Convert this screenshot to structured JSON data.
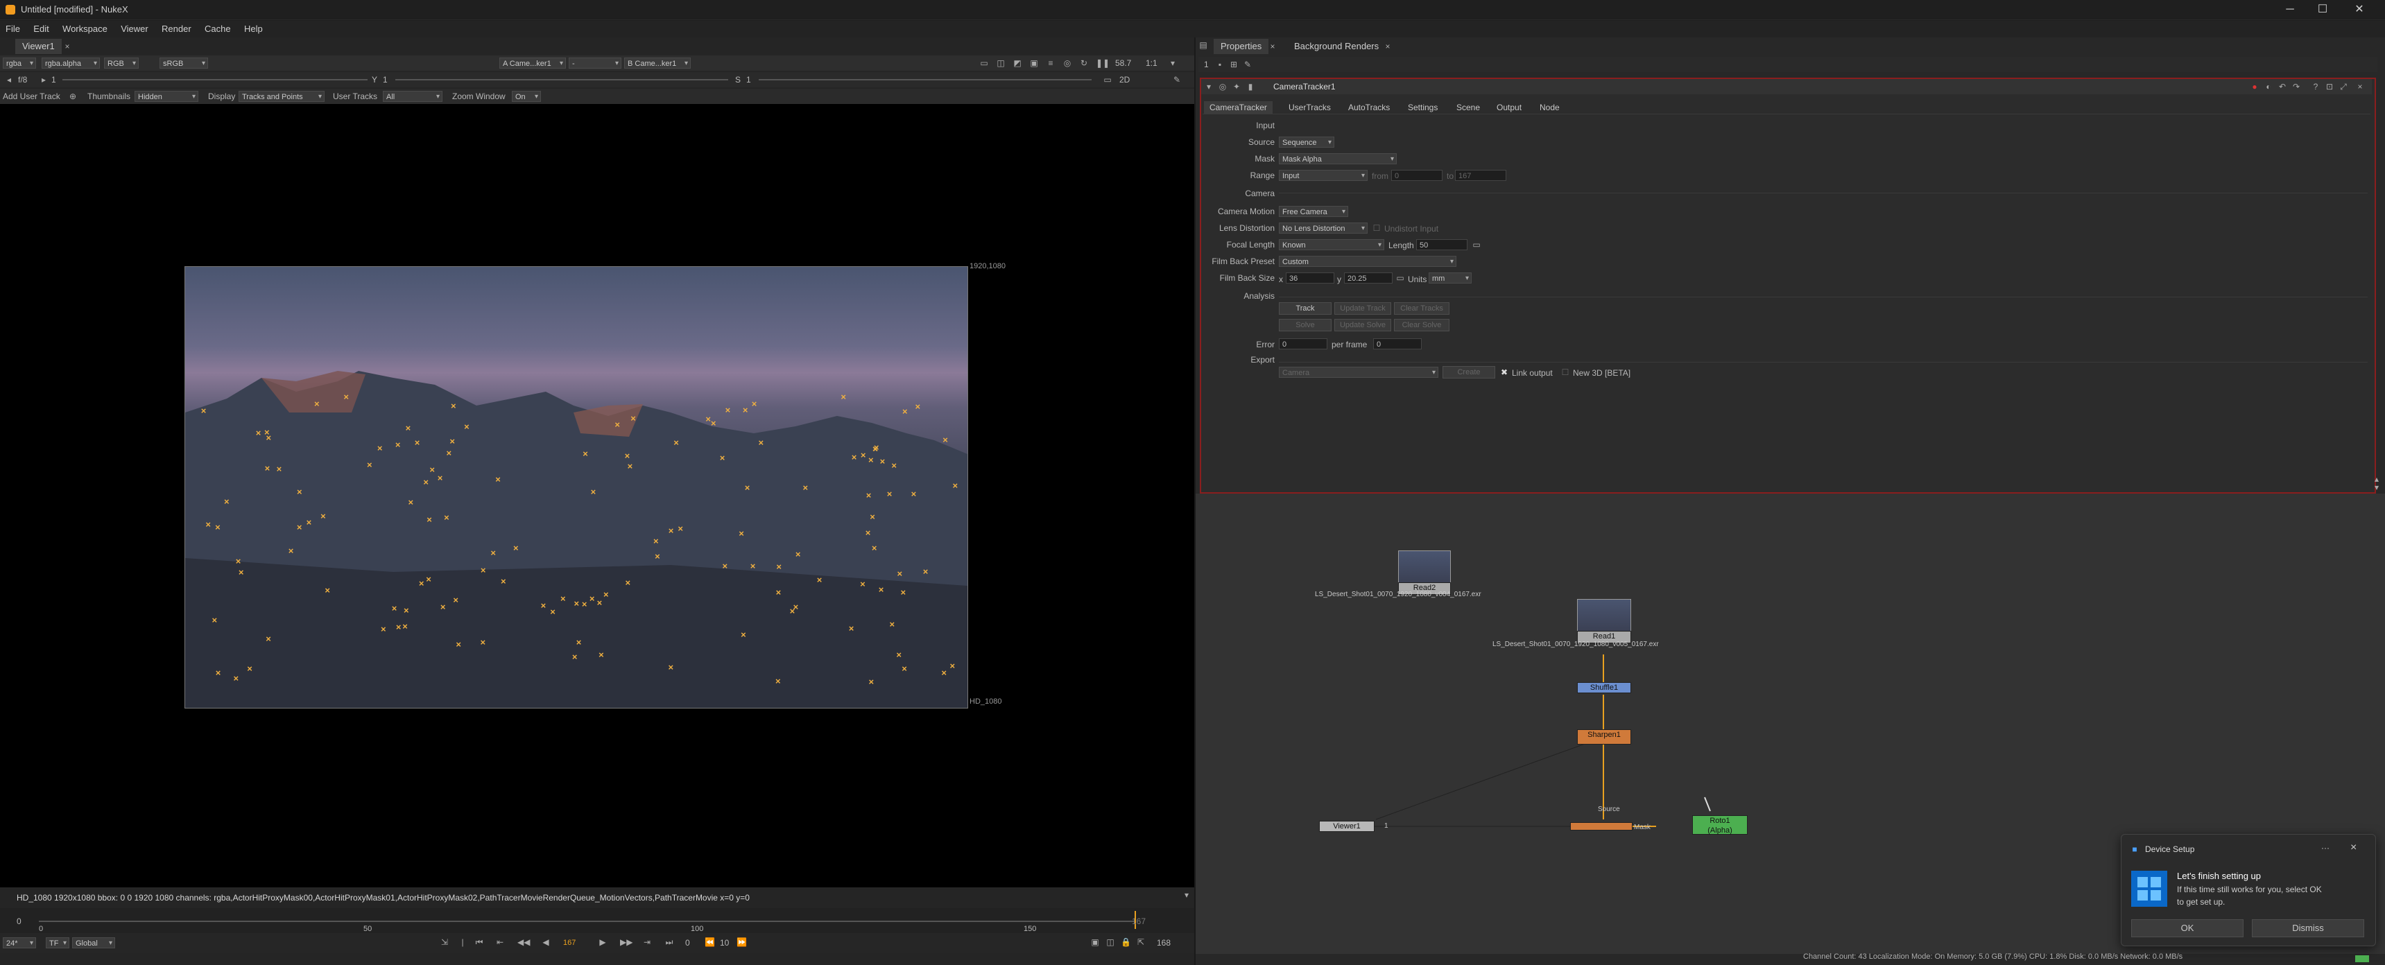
{
  "window": {
    "title": "Untitled [modified] - NukeX"
  },
  "menu": [
    "File",
    "Edit",
    "Workspace",
    "Viewer",
    "Render",
    "Cache",
    "Help"
  ],
  "viewer": {
    "tab": "Viewer1",
    "channels": "rgba",
    "alpha": "rgba.alpha",
    "colorspace_rgb": "RGB",
    "lut": "sRGB",
    "input_a": "A  Came...ker1",
    "input_a_op": "-",
    "input_b": "B  Came...ker1",
    "zoom": "58.7",
    "ratio": "1:1",
    "view_mode": "2D",
    "f_value": "f/8",
    "gain_value": "1",
    "y_value": "1",
    "s_value": "1",
    "tool_add_user_track": "Add User Track",
    "tool_thumbnails": "Thumbnails",
    "tool_thumbnails_val": "Hidden",
    "tool_display": "Display",
    "tool_display_val": "Tracks and Points",
    "tool_user_tracks": "User Tracks",
    "tool_user_tracks_val": "All",
    "tool_zoom_window": "Zoom Window",
    "tool_zoom_window_val": "On",
    "format_tr": "1920,1080",
    "format_br": "HD_1080",
    "info_line": "HD_1080 1920x1080  bbox: 0 0 1920 1080 channels: rgba,ActorHitProxyMask00,ActorHitProxyMask01,ActorHitProxyMask02,PathTracerMovieRenderQueue_MotionVectors,PathTracerMovie  x=0 y=0"
  },
  "timeline": {
    "start": "0",
    "end": "167",
    "ticks": [
      "0",
      "50",
      "100",
      "150"
    ],
    "current": "167",
    "fps": "24*",
    "tf": "TF",
    "global": "Global",
    "frame_field": "167",
    "step": "10",
    "end_field": "168",
    "inc": "0",
    "current_fraction": 1.0
  },
  "properties": {
    "tabs_top": [
      "Properties",
      "Background Renders"
    ],
    "node_name": "CameraTracker1",
    "tabs": [
      "CameraTracker",
      "UserTracks",
      "AutoTracks",
      "Settings",
      "Scene",
      "Output",
      "Node"
    ],
    "section_input": "Input",
    "source_label": "Source",
    "source_val": "Sequence",
    "mask_label": "Mask",
    "mask_val": "Mask Alpha",
    "range_label": "Range",
    "range_val": "Input",
    "from_label": "from",
    "from_val": "0",
    "to_label": "to",
    "to_val": "167",
    "section_camera": "Camera",
    "camera_motion_label": "Camera Motion",
    "camera_motion_val": "Free Camera",
    "lens_dist_label": "Lens Distortion",
    "lens_dist_val": "No Lens Distortion",
    "undistort_label": "Undistort Input",
    "focal_label": "Focal Length",
    "focal_val": "Known",
    "length_label": "Length",
    "length_val": "50",
    "filmback_preset_label": "Film Back Preset",
    "filmback_preset_val": "Custom",
    "filmback_size_label": "Film Back Size",
    "fb_x_label": "x",
    "fb_x_val": "36",
    "fb_y_label": "y",
    "fb_y_val": "20.25",
    "units_label": "Units",
    "units_val": "mm",
    "section_analysis": "Analysis",
    "btn_track": "Track",
    "btn_update_track": "Update Track",
    "btn_clear_tracks": "Clear Tracks",
    "btn_solve": "Solve",
    "btn_update_solve": "Update Solve",
    "btn_clear_solve": "Clear Solve",
    "error_label": "Error",
    "error_val": "0",
    "per_frame_label": "per frame",
    "per_frame_val": "0",
    "section_export": "Export",
    "export_val": "Camera",
    "btn_create": "Create",
    "link_output": "Link output",
    "new3d": "New 3D [BETA]"
  },
  "nodegraph": {
    "read2": {
      "name": "Read2",
      "file": "LS_Desert_Shot01_0070_1920_1080_v004_0167.exr"
    },
    "read1": {
      "name": "Read1",
      "file": "LS_Desert_Shot01_0070_1920_1080_v005_0167.exr"
    },
    "shuffle": "Shuffle1",
    "sharpen": "Sharpen1",
    "viewer": "Viewer1",
    "viewer_input": "1",
    "source_label": "Source",
    "mask_label": "Mask",
    "roto": "Roto1",
    "roto_sub": "(Alpha)"
  },
  "toast": {
    "title": "Device Setup",
    "heading": "Let's finish setting up",
    "body1": "If this time still works for you, select OK",
    "body2": "to get set up.",
    "ok": "OK",
    "dismiss": "Dismiss",
    "more": "···",
    "close": "×"
  },
  "statusbar": "Channel Count: 43  Localization Mode: On  Memory: 5.0 GB (7.9%)  CPU: 1.8%  Disk: 0.0 MB/s  Network: 0.0 MB/s",
  "colors": {
    "accent_red": "#8a1e1e",
    "marker": "#f0b040",
    "sharpen": "#d07a3a",
    "roto": "#4caf50",
    "shuffle": "#6b8fd0"
  }
}
